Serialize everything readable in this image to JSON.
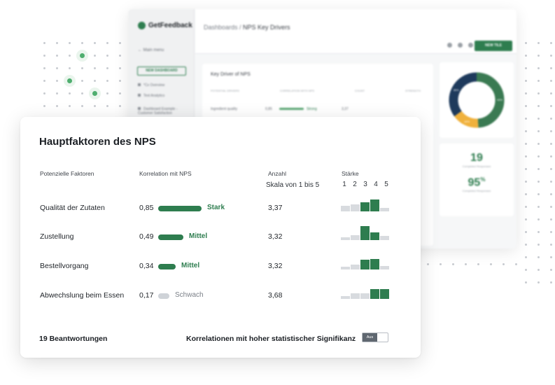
{
  "background_app": {
    "brand": "GetFeedback",
    "menu": "← Main menu",
    "new_dashboard": "NEW DASHBOARD",
    "nav": [
      "*Cx Overview",
      "Text Analytics",
      "Dashboard Example - Customer Satisfaction"
    ],
    "breadcrumb_root": "Dashboards",
    "breadcrumb_sep": " / ",
    "breadcrumb_page": "NPS Key Drivers",
    "new_tile": "NEW TILE",
    "card_title": "Key Driver of NPS",
    "card_cols": [
      "POTENTIAL DRIVERS",
      "CORRELATION WITH NPS",
      "COUNT",
      "STRENGTH"
    ],
    "card_row": {
      "label": "Ingredient quality",
      "corr": "0,85",
      "strength": "Strong",
      "count": "3,37"
    },
    "donut": {
      "values": [
        49,
        16,
        35
      ],
      "labels": [
        "49%",
        "16%",
        "35%"
      ],
      "colors": [
        "#3a7a52",
        "#f0b13c",
        "#1e3a5c"
      ]
    },
    "stats": [
      {
        "value": "19",
        "label": "Completed Responses"
      },
      {
        "value": "95",
        "suffix": "%",
        "label": "Completed Responses"
      }
    ]
  },
  "card": {
    "title": "Hauptfaktoren des NPS",
    "headers": {
      "factors": "Potenzielle Faktoren",
      "correlation": "Korrelation mit NPS",
      "count": "Anzahl",
      "count_sub": "Skala von 1 bis 5",
      "strength": "Stärke"
    },
    "scale": [
      "1",
      "2",
      "3",
      "4",
      "5"
    ],
    "rows": [
      {
        "label": "Qualität der Zutaten",
        "corr": "0,85",
        "strength": "Stark",
        "level": "strong",
        "count": "3,37",
        "hist": [
          0.4,
          0.5,
          0.65,
          0.85,
          0.25
        ],
        "hist_hi": [
          false,
          false,
          true,
          true,
          false
        ]
      },
      {
        "label": "Zustellung",
        "corr": "0,49",
        "strength": "Mittel",
        "level": "medium",
        "count": "3,32",
        "hist": [
          0.2,
          0.35,
          1.0,
          0.55,
          0.3
        ],
        "hist_hi": [
          false,
          false,
          true,
          true,
          false
        ]
      },
      {
        "label": "Bestellvorgang",
        "corr": "0,34",
        "strength": "Mittel",
        "level": "medium",
        "count": "3,32",
        "hist": [
          0.2,
          0.35,
          0.7,
          0.75,
          0.25
        ],
        "hist_hi": [
          false,
          false,
          true,
          true,
          false
        ]
      },
      {
        "label": "Abwechslung beim Essen",
        "corr": "0,17",
        "strength": "Schwach",
        "level": "weak",
        "count": "3,68",
        "hist": [
          0.2,
          0.4,
          0.4,
          0.7,
          0.7
        ],
        "hist_hi": [
          false,
          false,
          false,
          true,
          true
        ]
      }
    ],
    "footer_responses": "19 Beantwortungen",
    "footer_significance": "Korrelationen mit hoher statistischer Signifikanz",
    "toggle_label": "Aus"
  },
  "colors": {
    "accent": "#2e7d4f",
    "hist_light": "#d8dbdf",
    "weak": "#cfd3d8"
  }
}
